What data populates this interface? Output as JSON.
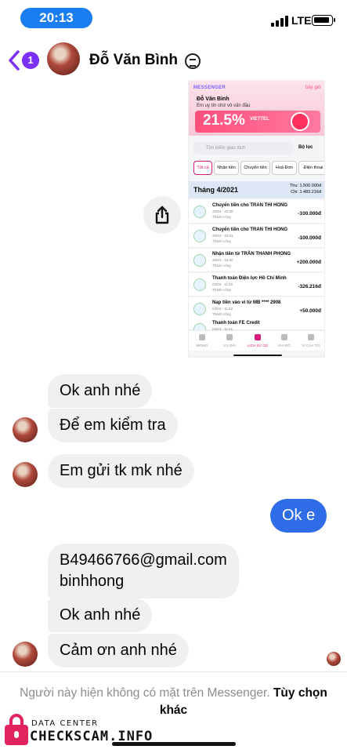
{
  "status_bar": {
    "time": "20:13",
    "network": "LTE"
  },
  "header": {
    "back_badge": "1",
    "contact_name": "Đỗ Văn Bình"
  },
  "shared_screenshot": {
    "app_label": "MESSENGER",
    "app_action": "bây giờ",
    "sender": "Đỗ Văn Bình",
    "preview": "Em uy tín chứ vô vấn đầu",
    "banner_percent": "21.5%",
    "banner_brand": "VIETTEL",
    "search_placeholder": "Tìm kiếm giao dịch",
    "filter_label": "Bộ lọc",
    "tabs": [
      "Tất cả",
      "Nhận tiền",
      "Chuyển tiền",
      "Hoá Đơn",
      "Điện thoại"
    ],
    "month": "Tháng 4/2021",
    "totals_in": "Thu: 1.500.000đ",
    "totals_out": "Chi: 1.483.216đ",
    "transactions": [
      {
        "title": "Chuyển tiền cho TRAN THI HONG",
        "date": "20/04 - 20:08",
        "status": "Thành công",
        "amount": "-100.000đ"
      },
      {
        "title": "Chuyển tiền cho TRAN THI HONG",
        "date": "20/04 - 16:31",
        "status": "Thành công",
        "amount": "-100.000đ"
      },
      {
        "title": "Nhận tiền từ TRẦN THANH PHONG",
        "date": "20/04 - 16:30",
        "status": "Thành công",
        "amount": "+200.000đ"
      },
      {
        "title": "Thanh toán Điện lực Hồ Chí Minh",
        "date": "03/04 - 11:52",
        "status": "Thành công",
        "amount": "-326.216đ"
      },
      {
        "title": "Nạp tiền vào ví từ MB **** 2908",
        "date": "03/04 - 11:52",
        "status": "Thành công",
        "amount": "+50.000đ"
      },
      {
        "title": "Thanh toán FE Credit",
        "date": "03/04 - 11:51",
        "status": "",
        "amount": ""
      }
    ],
    "nav": [
      "MOMO",
      "ƯU ĐÃI",
      "LỊCH SỬ GD",
      "KHI ĐỐ",
      "VÍ CỦA TÔI"
    ]
  },
  "messages": [
    {
      "text": "Ok anh nhé"
    },
    {
      "text": "Để em kiểm tra"
    },
    {
      "text": "Em gửi tk mk nhé"
    },
    {
      "text": "Ok e"
    },
    {
      "line1": "B49466766@gmail.com",
      "line2": "binhhong"
    },
    {
      "text": "Ok anh nhé"
    },
    {
      "text": "Cảm ơn anh nhé"
    }
  ],
  "footer": {
    "notice": "Người này hiện không có mặt trên Messenger.",
    "link": "Tùy chọn khác"
  },
  "watermark": {
    "small": "DATA CENTER",
    "big": "CHECKSCAM.INFO"
  },
  "colors": {
    "accent": "#2f6de8",
    "back": "#7b2ff7",
    "time_pill": "#1a7df2",
    "watermark_lock": "#e0245e"
  }
}
